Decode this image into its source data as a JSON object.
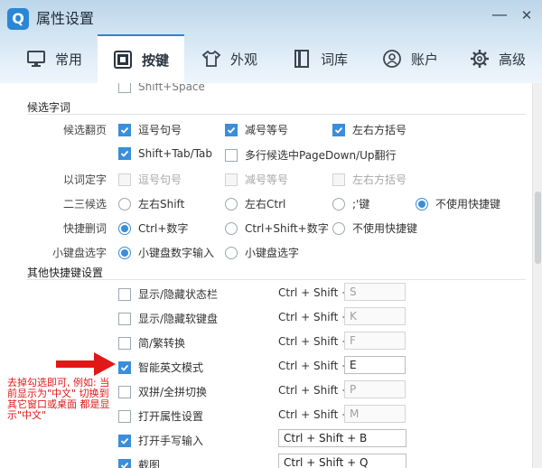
{
  "window": {
    "title": "属性设置",
    "logo_letter": "Q",
    "minimize": "—",
    "close": "✕"
  },
  "tabs": [
    {
      "label": "常用",
      "icon": "monitor-icon"
    },
    {
      "label": "按键",
      "icon": "keyboard-icon",
      "active": true
    },
    {
      "label": "外观",
      "icon": "shirt-icon"
    },
    {
      "label": "词库",
      "icon": "book-icon"
    },
    {
      "label": "账户",
      "icon": "user-icon"
    },
    {
      "label": "高级",
      "icon": "gear-icon"
    }
  ],
  "top_clipped": "Shift+Space",
  "candidate": {
    "section_title": "候选字词",
    "page_flip": {
      "label": "候选翻页",
      "options": [
        {
          "label": "逗号句号",
          "checked": true
        },
        {
          "label": "减号等号",
          "checked": true
        },
        {
          "label": "左右方括号",
          "checked": true
        },
        {
          "label": "Shift+Tab/Tab",
          "checked": true
        },
        {
          "label": "多行候选中PageDown/Up翻行",
          "checked": false
        }
      ]
    },
    "word_select": {
      "label": "以词定字",
      "options": [
        {
          "label": "逗号句号"
        },
        {
          "label": "减号等号"
        },
        {
          "label": "左右方括号"
        }
      ]
    },
    "second_third": {
      "label": "二三候选",
      "options": [
        {
          "label": "左右Shift",
          "selected": false
        },
        {
          "label": "左右Ctrl",
          "selected": false
        },
        {
          "label": ";'键",
          "selected": false
        },
        {
          "label": "不使用快捷键",
          "selected": true
        }
      ]
    },
    "quick_delete": {
      "label": "快捷删词",
      "options": [
        {
          "label": "Ctrl+数字",
          "selected": true
        },
        {
          "label": "Ctrl+Shift+数字",
          "selected": false
        },
        {
          "label": "不使用快捷键",
          "selected": false
        }
      ]
    },
    "numpad": {
      "label": "小键盘选字",
      "options": [
        {
          "label": "小键盘数字输入",
          "selected": true
        },
        {
          "label": "小键盘选字",
          "selected": false
        }
      ]
    }
  },
  "other": {
    "section_title": "其他快捷键设置",
    "prefix": "Ctrl + Shift +",
    "items": [
      {
        "label": "显示/隐藏状态栏",
        "checked": false,
        "key": "S"
      },
      {
        "label": "显示/隐藏软键盘",
        "checked": false,
        "key": "K"
      },
      {
        "label": "简/繁转换",
        "checked": false,
        "key": "F"
      },
      {
        "label": "智能英文模式",
        "checked": true,
        "key": "E"
      },
      {
        "label": "双拼/全拼切换",
        "checked": false,
        "key": "P"
      },
      {
        "label": "打开属性设置",
        "checked": false,
        "key": "M"
      },
      {
        "label": "打开手写输入",
        "checked": true,
        "full": "Ctrl + Shift + B"
      },
      {
        "label": "截图",
        "checked": true,
        "full": "Ctrl + Shift + Q"
      }
    ]
  },
  "annotation": {
    "text": "去掉勾选即可, 例如: 当前显示为\"中文\" 切换到其它窗口或桌面 都是显示\"中文\"",
    "color": "#e01818"
  },
  "colors": {
    "accent": "#3b8ed9",
    "header": "#cfe3f2"
  }
}
